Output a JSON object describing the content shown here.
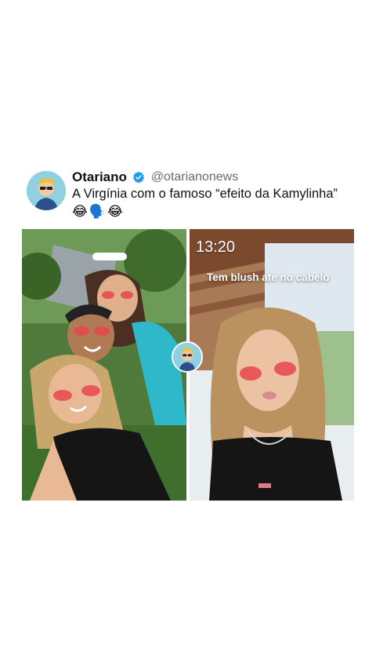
{
  "post": {
    "author_name": "Otariano",
    "author_handle": "@otarianonews",
    "verified": true,
    "text": "A Virgínia com o famoso “efeito da Kamylinha”",
    "emojis": "😂🗣️😂"
  },
  "media": {
    "right_panel_time": "13:20",
    "right_panel_caption": "Tem blush ate no cabelo"
  },
  "colors": {
    "verified_blue": "#1d9bf0",
    "handle_gray": "#6b6b6b",
    "text": "#111111",
    "blush_red": "#e8454f"
  },
  "icons": [
    "verified-badge-icon"
  ]
}
